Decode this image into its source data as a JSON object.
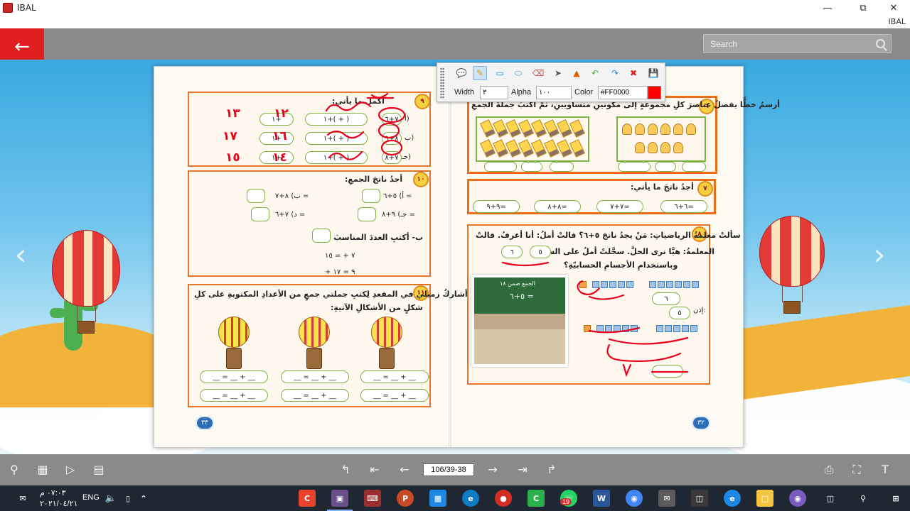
{
  "window": {
    "title": "IBAL",
    "brand": "IBAL",
    "minimize": "—",
    "restore": "⧉",
    "close": "✕"
  },
  "header": {
    "back_icon": "arrow-left-icon",
    "search_placeholder": "Search"
  },
  "annotation_toolbar": {
    "tools": [
      "comment",
      "pen",
      "rectangle",
      "ellipse",
      "eraser",
      "select",
      "stamp",
      "undo",
      "redo",
      "delete",
      "save"
    ],
    "active_tool": "pen",
    "width_label": "Width",
    "width_value": "٣",
    "alpha_label": "Alpha",
    "alpha_value": "١٠٠",
    "color_label": "Color",
    "color_value": "#FF0000"
  },
  "book": {
    "left_page": {
      "q9_prompt": "أكمل ما يأتي:",
      "q9_rows": [
        {
          "letter": "أ)",
          "eq": "٧+٦ = (     +     ) + ١ =     + ١ ="
        },
        {
          "letter": "ب)",
          "eq": "٨+٩ = (     +     ) + ١ =     + ١ ="
        },
        {
          "letter": "جـ)",
          "eq": "٧+٨ = (     +     ) + ١ =     + ١ ="
        }
      ],
      "q10_prompt": "أجدُ ناتجَ الجمعِ:",
      "q10_items": [
        "أ) ٥+٦ =",
        "ب) ٨+٧ =",
        "جـ) ٩+٨ =",
        "د) ٧+٦ ="
      ],
      "q10b_prompt": "ب- أكتبِ العددَ المناسبَ في",
      "q10b_rows": [
        "٧ +      = ١٥",
        "     + ٩ = ١٧"
      ],
      "q11_prompt_line1": "أشاركُ زميلي في المقعدِ لِكتبِ جملتي جمعٍ من الأعدادِ المكتوبةِ على كلِ",
      "q11_prompt_line2": "شكلٍ من الأشكالِ الآتيةِ:",
      "q11_blank": "__ = __ + __",
      "page_number": "٣٣"
    },
    "right_page": {
      "q6_prompt": "أرسمُ خطًّا يفصلُ عناصرَ كلِ مجموعةٍ إلى مكونينِ متساويينِ، ثمَّ أكتبُ جملةَ الجمعِ",
      "q7_prompt": "أجدُ ناتجَ ما يأتي:",
      "q7_items": [
        "٦+٦=",
        "٧+٧=",
        "٨+٨=",
        "٩+٩="
      ],
      "q8_line1": "سألتْ معلمةُ الرياضياتِ: مَنْ يجدُ ناتجَ ٥+٦؟ قالتْ أملُ: أنا أعرفُ. قالتْ",
      "q8_line2": "المعلمةُ: هيَّا نرى الحلَّ. سجَّلتْ أملُ على السبورةِ",
      "q8_line3": "وباستخدامِ الأجسامِ الحسابيّةِ؟",
      "q8_line2_values": [
        "٥",
        "٦"
      ],
      "q8_board_title": "الجمع ضمن ١٨",
      "q8_board_eq": "٥+٦ =",
      "q8_equation_labels": [
        "٦",
        "٥",
        "إذن:"
      ],
      "page_number": "٣٢"
    },
    "handwriting": {
      "left_answers": [
        "١٣",
        "١٢",
        "١٧",
        "١٦",
        "١٥",
        "١٤"
      ]
    }
  },
  "bottom_bar": {
    "page_indicator": "106/39-38"
  },
  "taskbar": {
    "time": "٠٧:٠٣ م",
    "date": "٢٠٢١/٠٤/٢١",
    "language": "ENG",
    "whatsapp_badge": "19"
  }
}
